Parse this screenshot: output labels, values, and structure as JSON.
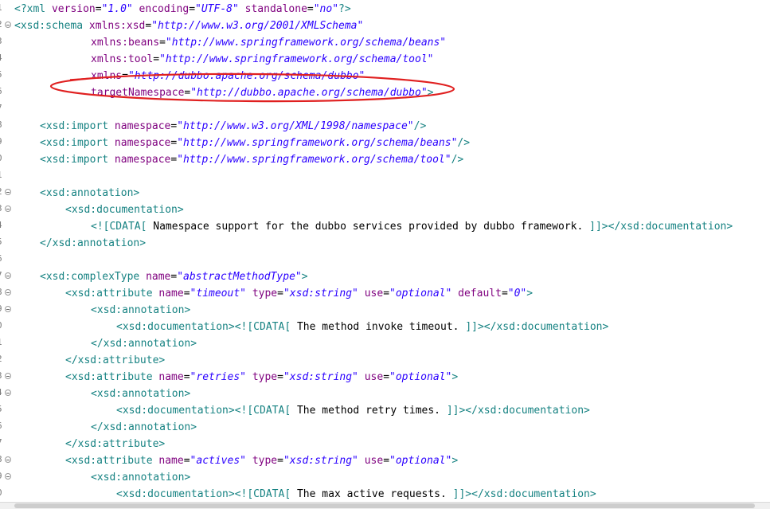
{
  "lines": [
    {
      "n": "1",
      "fold": false,
      "indent": 0,
      "tokens": [
        {
          "t": "tag",
          "v": "<?xml "
        },
        {
          "t": "an",
          "v": "version"
        },
        {
          "t": "eq",
          "v": "="
        },
        {
          "t": "val",
          "v": "\"1.0\""
        },
        {
          "t": "an",
          "v": " encoding"
        },
        {
          "t": "eq",
          "v": "="
        },
        {
          "t": "val",
          "v": "\"UTF-8\""
        },
        {
          "t": "an",
          "v": " standalone"
        },
        {
          "t": "eq",
          "v": "="
        },
        {
          "t": "val",
          "v": "\"no\""
        },
        {
          "t": "tag",
          "v": "?>"
        }
      ]
    },
    {
      "n": "2",
      "fold": true,
      "indent": 0,
      "tokens": [
        {
          "t": "tag",
          "v": "<xsd:schema "
        },
        {
          "t": "an",
          "v": "xmlns:xsd"
        },
        {
          "t": "eq",
          "v": "="
        },
        {
          "t": "val",
          "v": "\"http://www.w3.org/2001/XMLSchema\""
        }
      ]
    },
    {
      "n": "3",
      "fold": false,
      "indent": 3,
      "tokens": [
        {
          "t": "an",
          "v": "xmlns:beans"
        },
        {
          "t": "eq",
          "v": "="
        },
        {
          "t": "val",
          "v": "\"http://www.springframework.org/schema/beans\""
        }
      ]
    },
    {
      "n": "4",
      "fold": false,
      "indent": 3,
      "tokens": [
        {
          "t": "an",
          "v": "xmlns:tool"
        },
        {
          "t": "eq",
          "v": "="
        },
        {
          "t": "val",
          "v": "\"http://www.springframework.org/schema/tool\""
        }
      ]
    },
    {
      "n": "5",
      "fold": false,
      "indent": 3,
      "tokens": [
        {
          "t": "an",
          "v": "xmlns"
        },
        {
          "t": "eq",
          "v": "="
        },
        {
          "t": "val",
          "v": "\"http://dubbo.apache.org/schema/dubbo\""
        }
      ]
    },
    {
      "n": "6",
      "fold": false,
      "indent": 3,
      "tokens": [
        {
          "t": "an",
          "v": "targetNamespace"
        },
        {
          "t": "eq",
          "v": "="
        },
        {
          "t": "val",
          "v": "\"http://dubbo.apache.org/schema/dubbo\""
        },
        {
          "t": "tag",
          "v": ">"
        }
      ]
    },
    {
      "n": "7",
      "fold": false,
      "indent": 0,
      "tokens": []
    },
    {
      "n": "8",
      "fold": false,
      "indent": 1,
      "tokens": [
        {
          "t": "tag",
          "v": "<xsd:import "
        },
        {
          "t": "an",
          "v": "namespace"
        },
        {
          "t": "eq",
          "v": "="
        },
        {
          "t": "val",
          "v": "\"http://www.w3.org/XML/1998/namespace\""
        },
        {
          "t": "tag",
          "v": "/>"
        }
      ]
    },
    {
      "n": "9",
      "fold": false,
      "indent": 1,
      "tokens": [
        {
          "t": "tag",
          "v": "<xsd:import "
        },
        {
          "t": "an",
          "v": "namespace"
        },
        {
          "t": "eq",
          "v": "="
        },
        {
          "t": "val",
          "v": "\"http://www.springframework.org/schema/beans\""
        },
        {
          "t": "tag",
          "v": "/>"
        }
      ]
    },
    {
      "n": "0",
      "fold": false,
      "indent": 1,
      "tokens": [
        {
          "t": "tag",
          "v": "<xsd:import "
        },
        {
          "t": "an",
          "v": "namespace"
        },
        {
          "t": "eq",
          "v": "="
        },
        {
          "t": "val",
          "v": "\"http://www.springframework.org/schema/tool\""
        },
        {
          "t": "tag",
          "v": "/>"
        }
      ]
    },
    {
      "n": "1",
      "fold": false,
      "indent": 0,
      "tokens": []
    },
    {
      "n": "2",
      "fold": true,
      "indent": 1,
      "tokens": [
        {
          "t": "tag",
          "v": "<xsd:annotation>"
        }
      ]
    },
    {
      "n": "3",
      "fold": true,
      "indent": 2,
      "tokens": [
        {
          "t": "tag",
          "v": "<xsd:documentation>"
        }
      ]
    },
    {
      "n": "4",
      "fold": false,
      "indent": 3,
      "tokens": [
        {
          "t": "tag",
          "v": "<![CDATA["
        },
        {
          "t": "txt",
          "v": " Namespace support for the dubbo services provided by dubbo framework. "
        },
        {
          "t": "tag",
          "v": "]]></xsd:documentation>"
        }
      ]
    },
    {
      "n": "5",
      "fold": false,
      "indent": 1,
      "tokens": [
        {
          "t": "tag",
          "v": "</xsd:annotation>"
        }
      ]
    },
    {
      "n": "6",
      "fold": false,
      "indent": 0,
      "tokens": []
    },
    {
      "n": "7",
      "fold": true,
      "indent": 1,
      "tokens": [
        {
          "t": "tag",
          "v": "<xsd:complexType "
        },
        {
          "t": "an",
          "v": "name"
        },
        {
          "t": "eq",
          "v": "="
        },
        {
          "t": "val",
          "v": "\"abstractMethodType\""
        },
        {
          "t": "tag",
          "v": ">"
        }
      ]
    },
    {
      "n": "8",
      "fold": true,
      "indent": 2,
      "tokens": [
        {
          "t": "tag",
          "v": "<xsd:attribute "
        },
        {
          "t": "an",
          "v": "name"
        },
        {
          "t": "eq",
          "v": "="
        },
        {
          "t": "val",
          "v": "\"timeout\""
        },
        {
          "t": "an",
          "v": " type"
        },
        {
          "t": "eq",
          "v": "="
        },
        {
          "t": "val",
          "v": "\"xsd:string\""
        },
        {
          "t": "an",
          "v": " use"
        },
        {
          "t": "eq",
          "v": "="
        },
        {
          "t": "val",
          "v": "\"optional\""
        },
        {
          "t": "an",
          "v": " default"
        },
        {
          "t": "eq",
          "v": "="
        },
        {
          "t": "val",
          "v": "\"0\""
        },
        {
          "t": "tag",
          "v": ">"
        }
      ]
    },
    {
      "n": "9",
      "fold": true,
      "indent": 3,
      "tokens": [
        {
          "t": "tag",
          "v": "<xsd:annotation>"
        }
      ]
    },
    {
      "n": "0",
      "fold": false,
      "indent": 4,
      "tokens": [
        {
          "t": "tag",
          "v": "<xsd:documentation><![CDATA["
        },
        {
          "t": "txt",
          "v": " The method invoke timeout. "
        },
        {
          "t": "tag",
          "v": "]]></xsd:documentation>"
        }
      ]
    },
    {
      "n": "1",
      "fold": false,
      "indent": 3,
      "tokens": [
        {
          "t": "tag",
          "v": "</xsd:annotation>"
        }
      ]
    },
    {
      "n": "2",
      "fold": false,
      "indent": 2,
      "tokens": [
        {
          "t": "tag",
          "v": "</xsd:attribute>"
        }
      ]
    },
    {
      "n": "3",
      "fold": true,
      "indent": 2,
      "tokens": [
        {
          "t": "tag",
          "v": "<xsd:attribute "
        },
        {
          "t": "an",
          "v": "name"
        },
        {
          "t": "eq",
          "v": "="
        },
        {
          "t": "val",
          "v": "\"retries\""
        },
        {
          "t": "an",
          "v": " type"
        },
        {
          "t": "eq",
          "v": "="
        },
        {
          "t": "val",
          "v": "\"xsd:string\""
        },
        {
          "t": "an",
          "v": " use"
        },
        {
          "t": "eq",
          "v": "="
        },
        {
          "t": "val",
          "v": "\"optional\""
        },
        {
          "t": "tag",
          "v": ">"
        }
      ]
    },
    {
      "n": "4",
      "fold": true,
      "indent": 3,
      "tokens": [
        {
          "t": "tag",
          "v": "<xsd:annotation>"
        }
      ]
    },
    {
      "n": "5",
      "fold": false,
      "indent": 4,
      "tokens": [
        {
          "t": "tag",
          "v": "<xsd:documentation><![CDATA["
        },
        {
          "t": "txt",
          "v": " The method retry times. "
        },
        {
          "t": "tag",
          "v": "]]></xsd:documentation>"
        }
      ]
    },
    {
      "n": "6",
      "fold": false,
      "indent": 3,
      "tokens": [
        {
          "t": "tag",
          "v": "</xsd:annotation>"
        }
      ]
    },
    {
      "n": "7",
      "fold": false,
      "indent": 2,
      "tokens": [
        {
          "t": "tag",
          "v": "</xsd:attribute>"
        }
      ]
    },
    {
      "n": "8",
      "fold": true,
      "indent": 2,
      "tokens": [
        {
          "t": "tag",
          "v": "<xsd:attribute "
        },
        {
          "t": "an",
          "v": "name"
        },
        {
          "t": "eq",
          "v": "="
        },
        {
          "t": "val",
          "v": "\"actives\""
        },
        {
          "t": "an",
          "v": " type"
        },
        {
          "t": "eq",
          "v": "="
        },
        {
          "t": "val",
          "v": "\"xsd:string\""
        },
        {
          "t": "an",
          "v": " use"
        },
        {
          "t": "eq",
          "v": "="
        },
        {
          "t": "val",
          "v": "\"optional\""
        },
        {
          "t": "tag",
          "v": ">"
        }
      ]
    },
    {
      "n": "9",
      "fold": true,
      "indent": 3,
      "tokens": [
        {
          "t": "tag",
          "v": "<xsd:annotation>"
        }
      ]
    },
    {
      "n": "0",
      "fold": false,
      "indent": 4,
      "tokens": [
        {
          "t": "tag",
          "v": "<xsd:documentation><![CDATA["
        },
        {
          "t": "txt",
          "v": " The max active requests. "
        },
        {
          "t": "tag",
          "v": "]]></xsd:documentation>"
        }
      ]
    }
  ],
  "annotation": {
    "color": "#e02020",
    "highlighted_line": "targetNamespace"
  }
}
